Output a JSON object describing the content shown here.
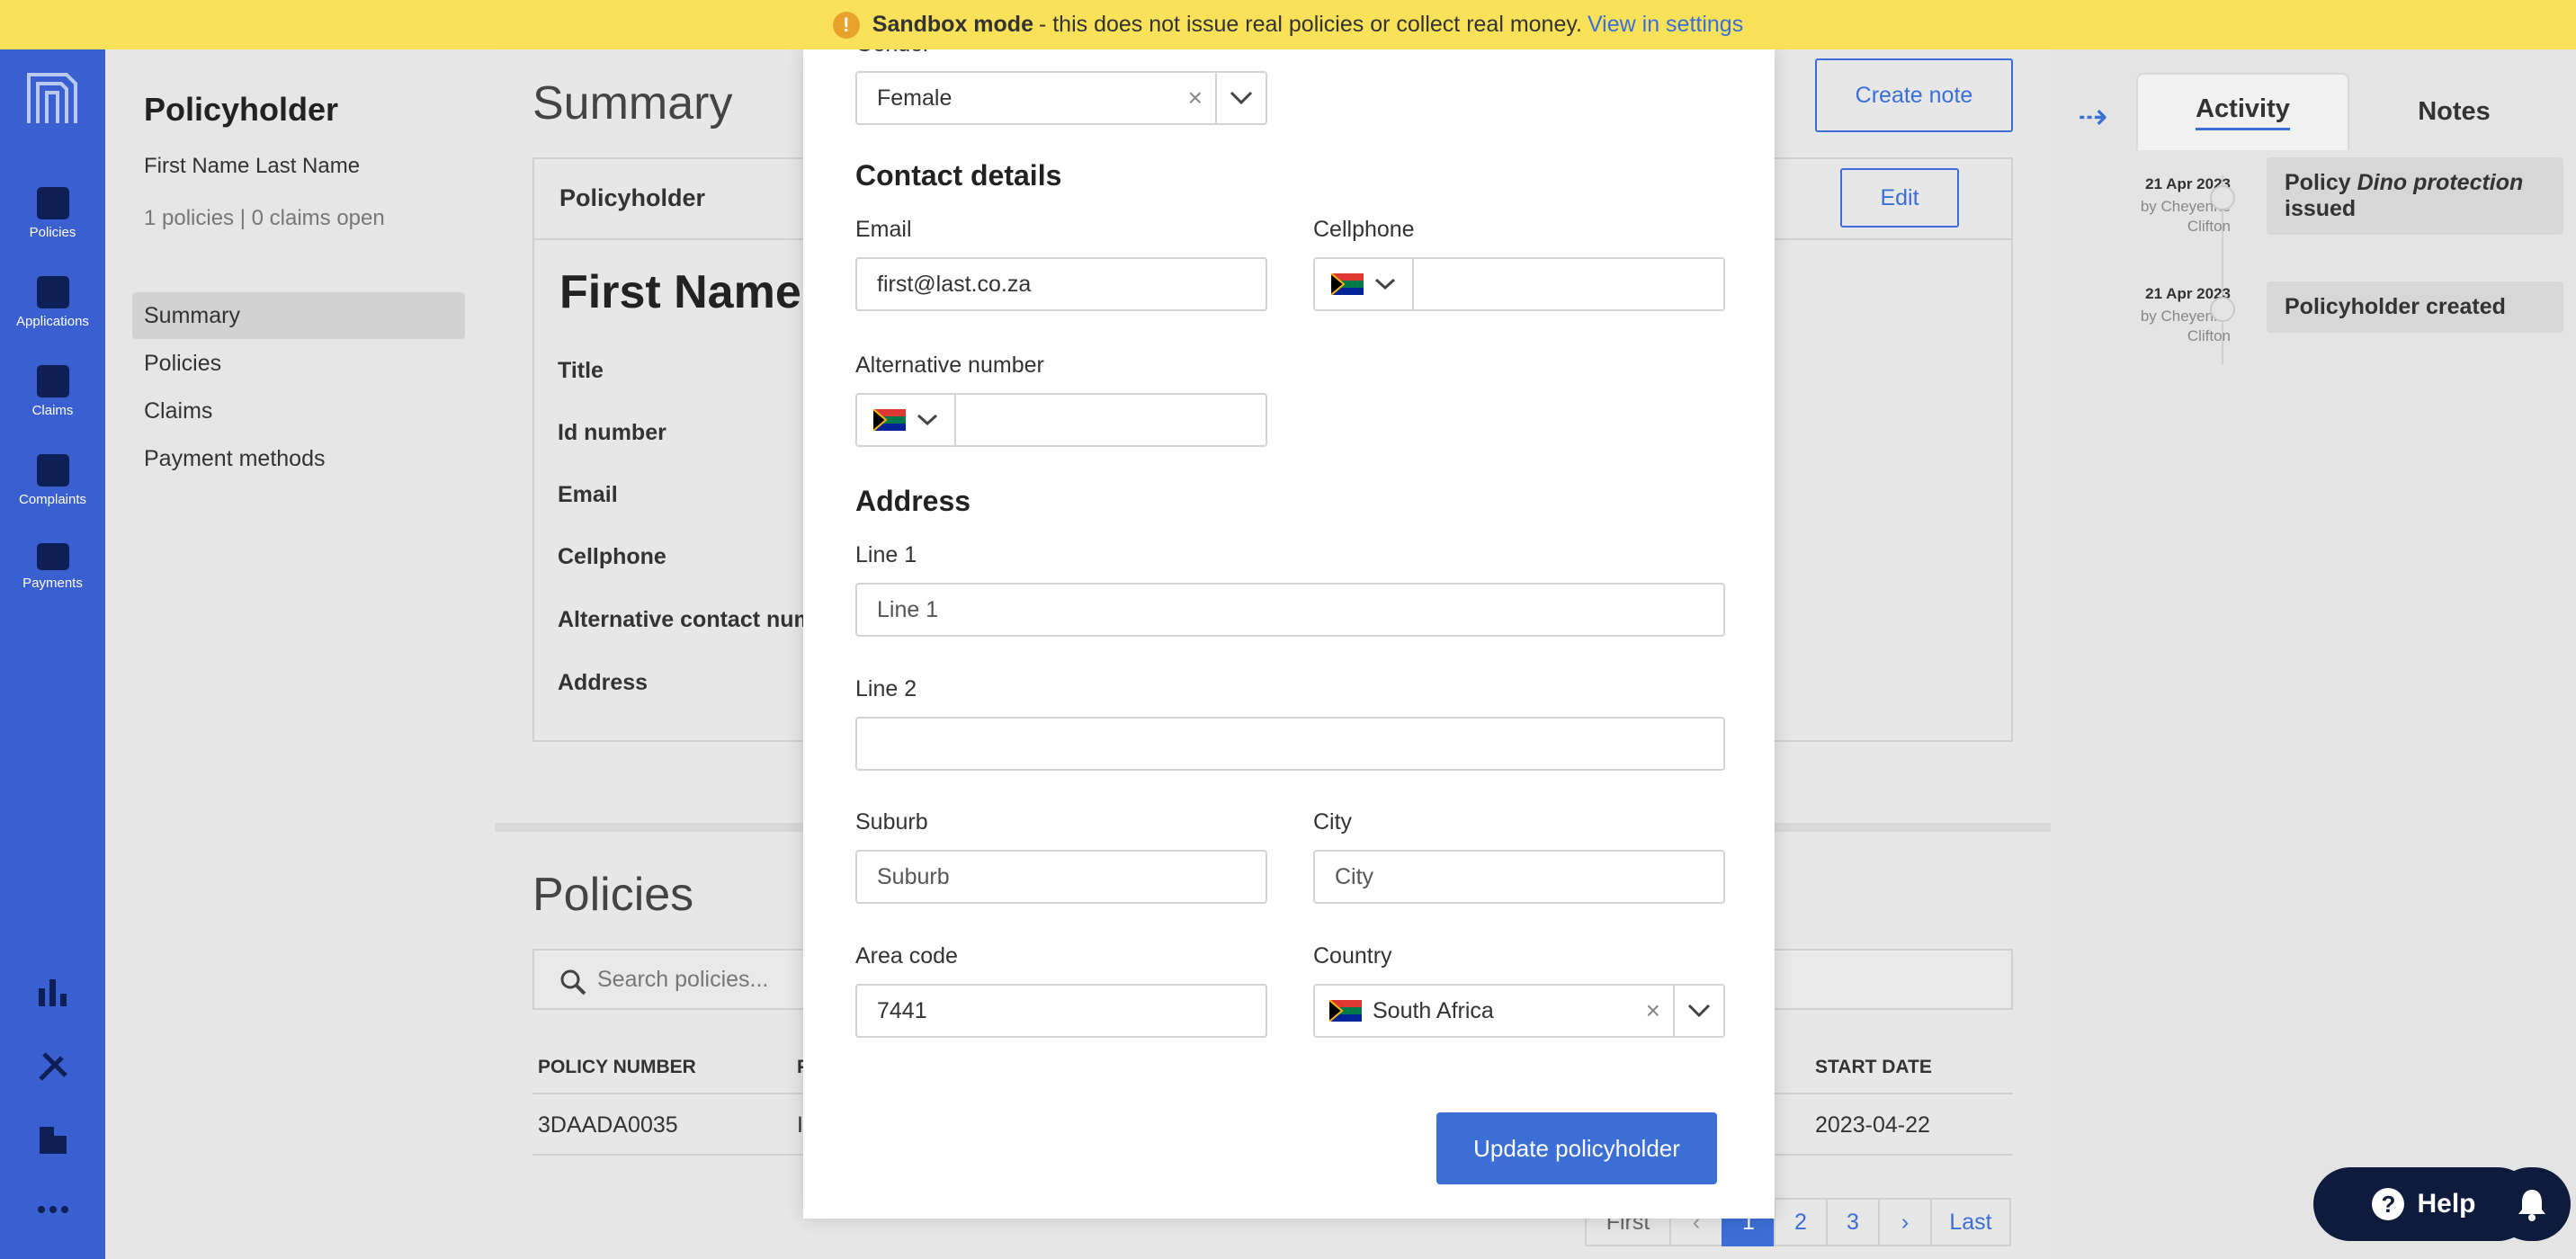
{
  "banner": {
    "title": "Sandbox mode",
    "message": "- this does not issue real policies or collect real money.",
    "link": "View in settings",
    "icon": "warning-icon"
  },
  "rail": {
    "items": [
      {
        "label": "Policies",
        "icon": "policies-icon"
      },
      {
        "label": "Applications",
        "icon": "applications-icon"
      },
      {
        "label": "Claims",
        "icon": "claims-icon"
      },
      {
        "label": "Complaints",
        "icon": "complaints-icon"
      },
      {
        "label": "Payments",
        "icon": "payments-icon"
      }
    ]
  },
  "subnav": {
    "title": "Policyholder",
    "name": "First Name Last Name",
    "meta": "1 policies | 0 claims open",
    "items": [
      "Summary",
      "Policies",
      "Claims",
      "Payment methods"
    ]
  },
  "main": {
    "summary_title": "Summary",
    "create_note": "Create note",
    "card_title": "Policyholder",
    "edit": "Edit",
    "big_name": "First Name L",
    "fields": [
      "Title",
      "Id number",
      "Email",
      "Cellphone",
      "Alternative contact num",
      "Address"
    ],
    "policies_title": "Policies",
    "search_placeholder": "Search policies...",
    "table": {
      "col_policy_number": "POLICY NUMBER",
      "col_partial": "P",
      "col_start_date": "START DATE",
      "row_policy_number": "3DAADA0035",
      "row_partial": "I",
      "row_start_date": "2023-04-22"
    },
    "pager": {
      "first": "First",
      "prev": "‹",
      "pages": [
        "1",
        "2",
        "3"
      ],
      "next": "›",
      "last": "Last"
    }
  },
  "activity": {
    "tab_activity": "Activity",
    "tab_notes": "Notes",
    "events": [
      {
        "date": "21 Apr 2023",
        "by": "by Cheyenne Clifton",
        "pre": "Policy ",
        "em": "Dino protection",
        "post": " issued"
      },
      {
        "date": "21 Apr 2023",
        "by": "by Cheyenne Clifton",
        "pre": "Policyholder created",
        "em": "",
        "post": ""
      }
    ]
  },
  "modal": {
    "gender_label_partial": "Gender",
    "gender_value": "Female",
    "contact_heading": "Contact details",
    "email_label": "Email",
    "email_value": "first@last.co.za",
    "cellphone_label": "Cellphone",
    "alt_label": "Alternative number",
    "address_heading": "Address",
    "line1_label": "Line 1",
    "line1_placeholder": "Line 1",
    "line2_label": "Line 2",
    "suburb_label": "Suburb",
    "suburb_placeholder": "Suburb",
    "city_label": "City",
    "city_placeholder": "City",
    "area_label": "Area code",
    "area_value": "7441",
    "country_label": "Country",
    "country_value": "South Africa",
    "submit": "Update policyholder"
  },
  "help": {
    "label": "Help"
  },
  "colors": {
    "primary": "#3b6fd6",
    "rail": "#3a5fd0",
    "banner": "#fae15a",
    "help": "#0f1b3d"
  }
}
